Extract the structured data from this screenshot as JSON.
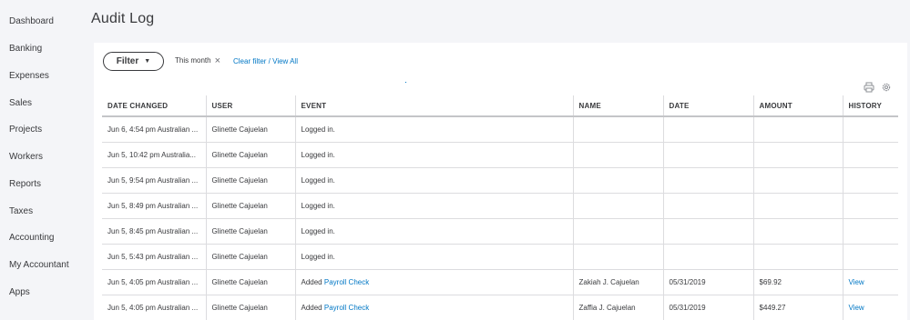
{
  "sidebar": {
    "items": [
      {
        "label": "Dashboard"
      },
      {
        "label": "Banking"
      },
      {
        "label": "Expenses"
      },
      {
        "label": "Sales"
      },
      {
        "label": "Projects"
      },
      {
        "label": "Workers"
      },
      {
        "label": "Reports"
      },
      {
        "label": "Taxes"
      },
      {
        "label": "Accounting"
      },
      {
        "label": "My Accountant"
      },
      {
        "label": "Apps"
      }
    ]
  },
  "page": {
    "title": "Audit Log"
  },
  "toolbar": {
    "filter_label": "Filter",
    "active_filter": "This month",
    "clear_link": "Clear filter / View All",
    "icons": [
      "print-icon",
      "gear-icon"
    ]
  },
  "table": {
    "columns": [
      "DATE CHANGED",
      "USER",
      "EVENT",
      "NAME",
      "DATE",
      "AMOUNT",
      "HISTORY"
    ],
    "rows": [
      {
        "date_changed": "Jun 6, 4:54 pm Australian ...",
        "user": "Glinette Cajuelan",
        "event_prefix": "Logged in.",
        "event_link": "",
        "name": "",
        "date": "",
        "amount": "",
        "history": ""
      },
      {
        "date_changed": "Jun 5, 10:42 pm Australia...",
        "user": "Glinette Cajuelan",
        "event_prefix": "Logged in.",
        "event_link": "",
        "name": "",
        "date": "",
        "amount": "",
        "history": ""
      },
      {
        "date_changed": "Jun 5, 9:54 pm Australian ...",
        "user": "Glinette Cajuelan",
        "event_prefix": "Logged in.",
        "event_link": "",
        "name": "",
        "date": "",
        "amount": "",
        "history": ""
      },
      {
        "date_changed": "Jun 5, 8:49 pm Australian ...",
        "user": "Glinette Cajuelan",
        "event_prefix": "Logged in.",
        "event_link": "",
        "name": "",
        "date": "",
        "amount": "",
        "history": ""
      },
      {
        "date_changed": "Jun 5, 8:45 pm Australian ...",
        "user": "Glinette Cajuelan",
        "event_prefix": "Logged in.",
        "event_link": "",
        "name": "",
        "date": "",
        "amount": "",
        "history": ""
      },
      {
        "date_changed": "Jun 5, 5:43 pm Australian ...",
        "user": "Glinette Cajuelan",
        "event_prefix": "Logged in.",
        "event_link": "",
        "name": "",
        "date": "",
        "amount": "",
        "history": ""
      },
      {
        "date_changed": "Jun 5, 4:05 pm Australian ...",
        "user": "Glinette Cajuelan",
        "event_prefix": "Added",
        "event_link": "Payroll Check",
        "name": "Zakiah J. Cajuelan",
        "date": "05/31/2019",
        "amount": "$69.92",
        "history": "View"
      },
      {
        "date_changed": "Jun 5, 4:05 pm Australian ...",
        "user": "Glinette Cajuelan",
        "event_prefix": "Added",
        "event_link": "Payroll Check",
        "name": "Zaffia J. Cajuelan",
        "date": "05/31/2019",
        "amount": "$449.27",
        "history": "View"
      }
    ]
  },
  "colors": {
    "link": "#0077c5",
    "text": "#393a3d",
    "background": "#f4f5f8"
  }
}
